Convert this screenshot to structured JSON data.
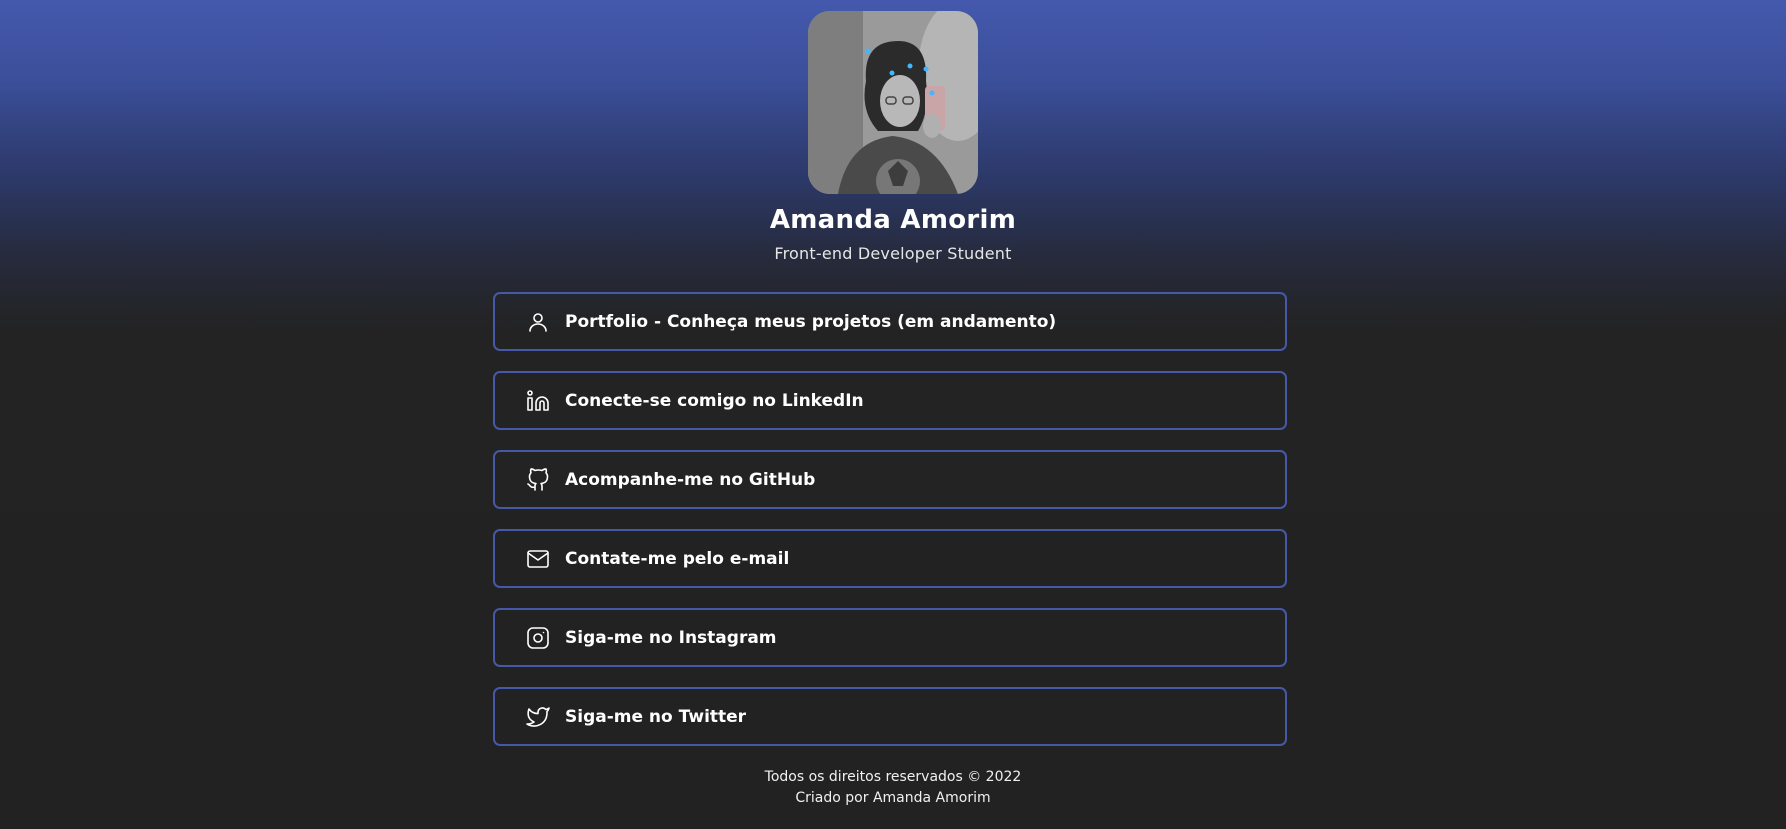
{
  "profile": {
    "name": "Amanda Amorim",
    "subtitle": "Front-end Developer Student"
  },
  "links": [
    {
      "icon": "user-icon",
      "label": "Portfolio - Conheça meus projetos (em andamento)"
    },
    {
      "icon": "linkedin-icon",
      "label": "Conecte-se comigo no LinkedIn"
    },
    {
      "icon": "github-icon",
      "label": "Acompanhe-me no GitHub"
    },
    {
      "icon": "mail-icon",
      "label": "Contate-me pelo e-mail"
    },
    {
      "icon": "instagram-icon",
      "label": "Siga-me no Instagram"
    },
    {
      "icon": "twitter-icon",
      "label": "Siga-me no Twitter"
    }
  ],
  "footer": {
    "rights": "Todos os direitos reservados © 2022",
    "credit": "Criado por Amanda Amorim"
  },
  "colors": {
    "accent": "#4658a8",
    "background": "#222222",
    "gradient_top": "#4459ad"
  }
}
